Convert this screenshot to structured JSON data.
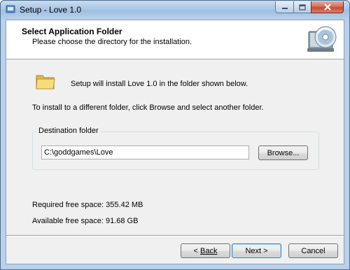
{
  "window": {
    "title": "Setup - Love 1.0"
  },
  "title_controls": {
    "minimize": "minimize-icon",
    "maximize": "maximize-icon",
    "close": "close-icon"
  },
  "header": {
    "title": "Select Application Folder",
    "subtitle": "Please choose the directory for the installation."
  },
  "body": {
    "install_text": "Setup will install Love 1.0 in the folder shown below.",
    "browse_hint": "To install to a different folder, click Browse and select another folder."
  },
  "destination": {
    "group_label": "Destination folder",
    "path": "C:\\goddgames\\Love",
    "browse_label": "Browse..."
  },
  "space": {
    "required": "Required free space: 355.42 MB",
    "available": "Available free space: 91.68 GB"
  },
  "buttons": {
    "back_arrow": "< ",
    "back_label": "Back",
    "next_label": "Next >",
    "cancel_label": "Cancel"
  }
}
